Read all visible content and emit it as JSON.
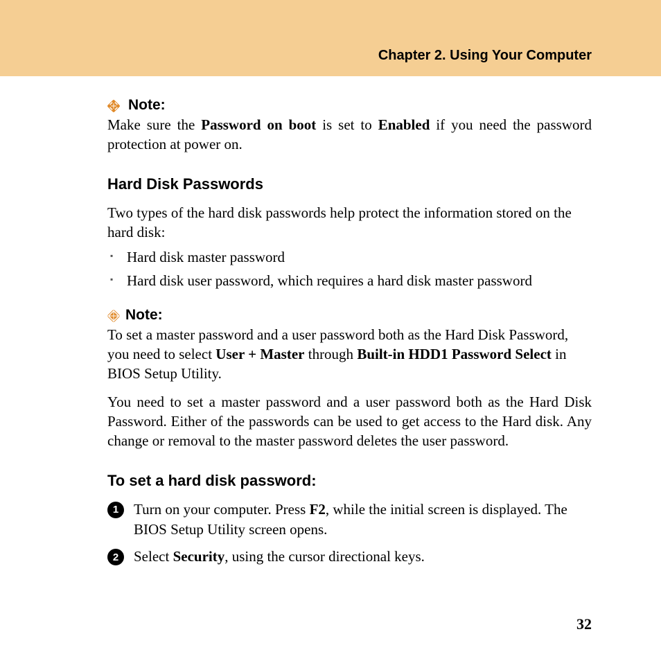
{
  "header": {
    "chapter_title": "Chapter 2. Using Your Computer"
  },
  "note1": {
    "label": "Note:",
    "text_pre": "Make sure the ",
    "bold1": "Password on boot",
    "text_mid": " is set to ",
    "bold2": "Enabled",
    "text_post": " if you need the password protection at power on."
  },
  "section1": {
    "heading": "Hard Disk Passwords",
    "intro": "Two types of the hard disk passwords help protect the information stored on the hard disk:",
    "bullets": [
      "Hard disk master password",
      "Hard disk user password, which requires a hard disk master password"
    ]
  },
  "note2": {
    "label": "Note:",
    "text_pre": "To set a master password and a user password both as the Hard Disk Password, you need to select ",
    "bold1": "User + Master",
    "text_mid": " through ",
    "bold2": "Built-in HDD1 Password Select",
    "text_post": " in BIOS Setup Utility."
  },
  "para2": "You need to set a master password and a user password both as the Hard Disk Password. Either of the passwords can be used to get access to the Hard disk. Any change or removal to the master password deletes the user password.",
  "section2": {
    "heading": "To set a hard disk password:",
    "steps": {
      "s1_pre": "Turn on your computer. Press ",
      "s1_bold": "F2",
      "s1_post": ", while the initial screen is displayed. The BIOS Setup Utility screen opens.",
      "s2_pre": "Select ",
      "s2_bold": "Security",
      "s2_post": ", using the cursor directional keys."
    }
  },
  "page_number": "32"
}
